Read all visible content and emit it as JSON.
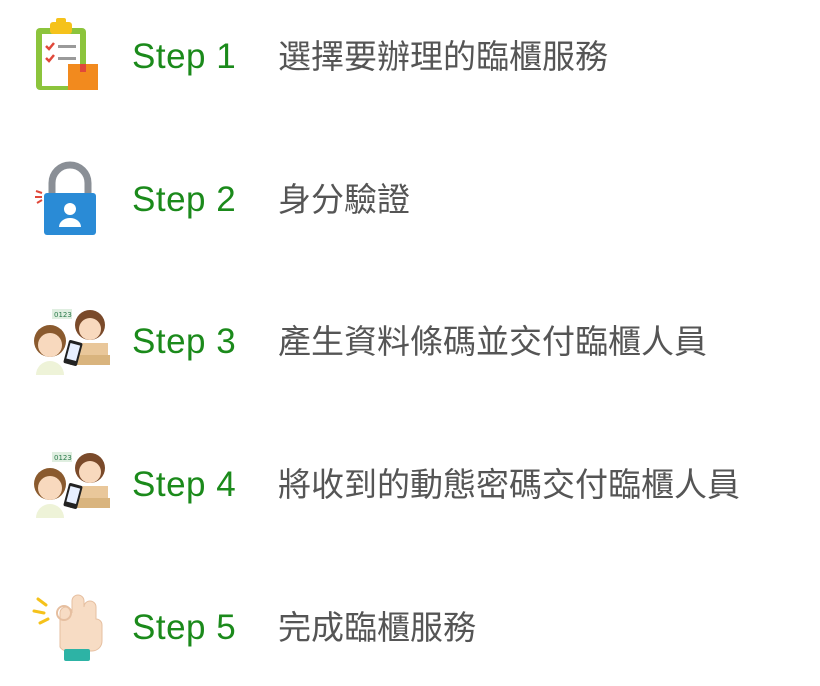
{
  "colors": {
    "step_label": "#1b8a1b",
    "step_text": "#555555",
    "background": "#ffffff"
  },
  "steps": [
    {
      "label": "Step 1",
      "text": "選擇要辦理的臨櫃服務",
      "icon": "checklist-clipboard-icon"
    },
    {
      "label": "Step 2",
      "text": "身分驗證",
      "icon": "padlock-user-icon"
    },
    {
      "label": "Step 3",
      "text": "產生資料條碼並交付臨櫃人員",
      "icon": "customer-and-clerk-icon"
    },
    {
      "label": "Step 4",
      "text": "將收到的動態密碼交付臨櫃人員",
      "icon": "customer-and-clerk-icon"
    },
    {
      "label": "Step 5",
      "text": "完成臨櫃服務",
      "icon": "ok-hand-icon"
    }
  ]
}
